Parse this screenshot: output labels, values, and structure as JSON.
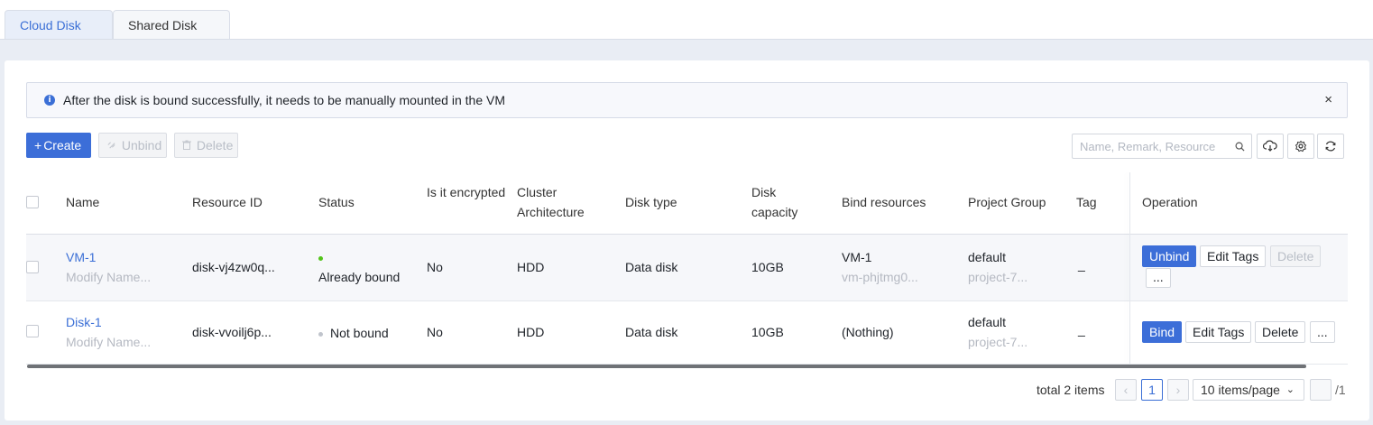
{
  "tabs": [
    {
      "label": "Cloud Disk",
      "active": true
    },
    {
      "label": "Shared Disk",
      "active": false
    }
  ],
  "notice": {
    "text": "After the disk is bound successfully, it needs to be manually mounted in the VM",
    "close": "×",
    "icon": "info-icon"
  },
  "toolbar": {
    "create_label": "Create",
    "create_icon": "+",
    "unbind_label": "Unbind",
    "delete_label": "Delete",
    "search_placeholder": "Name, Remark, Resource"
  },
  "table": {
    "columns": {
      "name": "Name",
      "resource_id": "Resource ID",
      "status": "Status",
      "encrypted": "Is it encrypted",
      "cluster": "Cluster Architecture",
      "disk_type": "Disk type",
      "capacity": "Disk capacity",
      "bind": "Bind resources",
      "project": "Project Group",
      "tag": "Tag",
      "operation": "Operation"
    },
    "rows": [
      {
        "name": "VM-1",
        "name_sub": "Modify Name...",
        "resource_id": "disk-vj4zw0q...",
        "status": "Already bound",
        "status_color": "#52c41a",
        "encrypted": "No",
        "cluster": "HDD",
        "disk_type": "Data disk",
        "capacity": "10GB",
        "bind": "VM-1",
        "bind_sub": "vm-phjtmg0...",
        "project": "default",
        "project_sub": "project-7...",
        "tag": "_",
        "ops": {
          "primary": "Unbind",
          "edit": "Edit Tags",
          "delete": "Delete",
          "more": "..."
        }
      },
      {
        "name": "Disk-1",
        "name_sub": "Modify Name...",
        "resource_id": "disk-vvoilj6p...",
        "status": "Not bound",
        "status_color": "#c0c4cc",
        "encrypted": "No",
        "cluster": "HDD",
        "disk_type": "Data disk",
        "capacity": "10GB",
        "bind": "(Nothing)",
        "project": "default",
        "project_sub": "project-7...",
        "tag": "_",
        "ops": {
          "primary": "Bind",
          "edit": "Edit Tags",
          "delete": "Delete",
          "more": "..."
        }
      }
    ]
  },
  "pagination": {
    "total": "total 2 items",
    "prev": "‹",
    "current": "1",
    "next": "›",
    "page_size": "10 items/page",
    "page_count": "/1"
  }
}
